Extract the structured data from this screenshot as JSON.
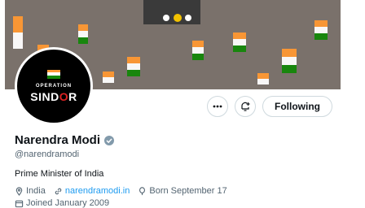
{
  "profile": {
    "name": "Narendra Modi",
    "handle": "@narendramodi",
    "bio": "Prime Minister of India",
    "location": "India",
    "website": "narendramodi.in",
    "born": "Born September 17",
    "joined": "Joined January 2009",
    "verified_icon": "verified-badge-icon"
  },
  "avatar": {
    "line1": "OPERATION",
    "line2_pre": "SIND",
    "line2_o": "O",
    "line2_post": "R"
  },
  "actions": {
    "more_icon": "more-icon",
    "notify_icon": "bell-plus-icon",
    "follow_label": "Following"
  },
  "colors": {
    "accent": "#1d9bf0",
    "verified": "#829aab"
  }
}
